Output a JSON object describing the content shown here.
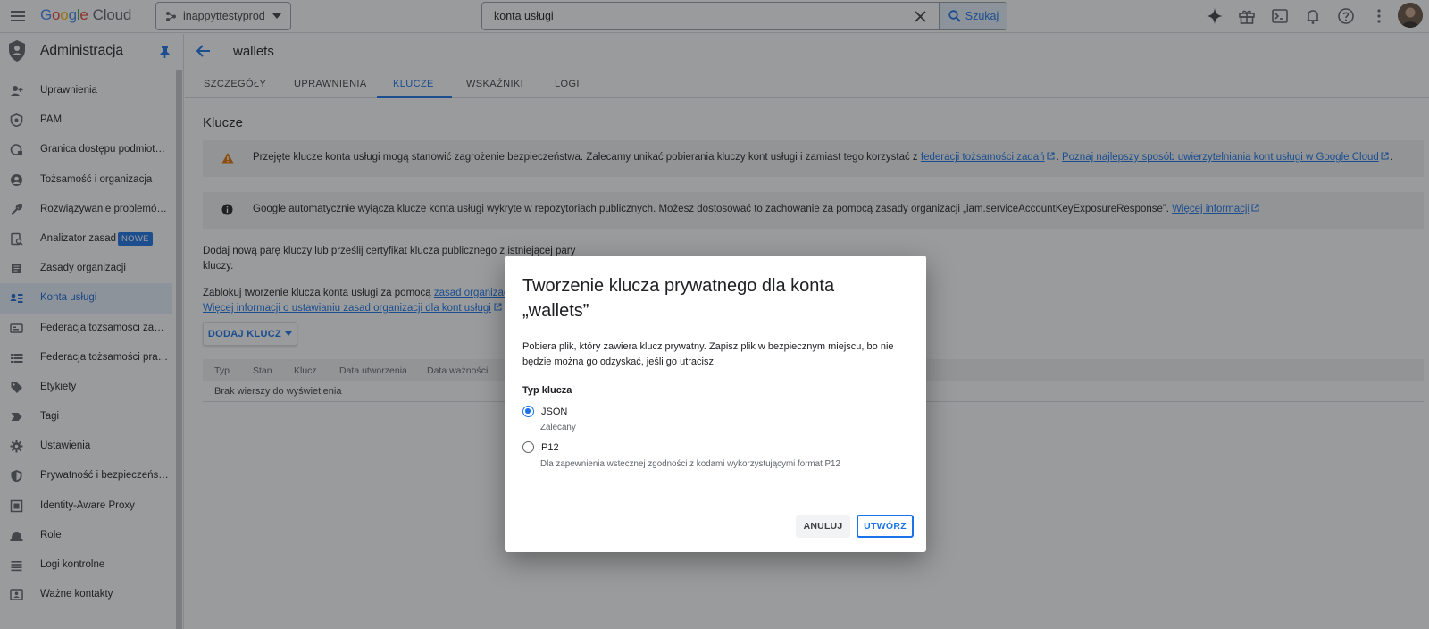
{
  "topbar": {
    "logo_google": "Google",
    "logo_cloud": "Cloud",
    "project": "inappyttestyprod",
    "search_value": "konta usługi",
    "search_button": "Szukaj"
  },
  "sidebar": {
    "title": "Administracja",
    "items": [
      {
        "label": "Uprawnienia",
        "icon": "person-add-icon"
      },
      {
        "label": "PAM",
        "icon": "shield-icon"
      },
      {
        "label": "Granica dostępu podmiot…",
        "icon": "access-boundary-icon"
      },
      {
        "label": "Tożsamość i organizacja",
        "icon": "account-circle-icon"
      },
      {
        "label": "Rozwiązywanie problemó…",
        "icon": "wrench-icon"
      },
      {
        "label": "Analizator zasad",
        "icon": "policy-analyzer-icon",
        "badge": "NOWE"
      },
      {
        "label": "Zasady organizacji",
        "icon": "document-icon"
      },
      {
        "label": "Konta usługi",
        "icon": "service-account-icon"
      },
      {
        "label": "Federacja tożsamości za…",
        "icon": "id-card-icon"
      },
      {
        "label": "Federacja tożsamości pra…",
        "icon": "list-icon"
      },
      {
        "label": "Etykiety",
        "icon": "tag-icon"
      },
      {
        "label": "Tagi",
        "icon": "label-arrow-icon"
      },
      {
        "label": "Ustawienia",
        "icon": "gear-icon"
      },
      {
        "label": "Prywatność i bezpieczeńs…",
        "icon": "privacy-shield-icon"
      },
      {
        "label": "Identity-Aware Proxy",
        "icon": "proxy-icon"
      },
      {
        "label": "Role",
        "icon": "role-hat-icon"
      },
      {
        "label": "Logi kontrolne",
        "icon": "lines-icon"
      },
      {
        "label": "Ważne kontakty",
        "icon": "contacts-icon"
      }
    ],
    "active_index": 7
  },
  "page": {
    "title": "wallets",
    "tabs": [
      "SZCZEGÓŁY",
      "UPRAWNIENIA",
      "KLUCZE",
      "WSKAŹNIKI",
      "LOGI"
    ],
    "active_tab": "KLUCZE",
    "section_title": "Klucze",
    "warning": {
      "text": "Przejęte klucze konta usługi mogą stanowić zagrożenie bezpieczeństwa. Zalecamy unikać pobierania kluczy kont usługi i zamiast tego korzystać z ",
      "link1": "federacji tożsamości zadań",
      "sep": ". ",
      "link2": "Poznaj najlepszy sposób uwierzytelniania kont usługi w Google Cloud",
      "end": "."
    },
    "info": {
      "text": "Google automatycznie wyłącza klucze konta usługi wykryte w repozytoriach publicznych. Możesz dostosować to zachowanie za pomocą zasady organizacji „iam.serviceAccountKeyExposureResponse”. ",
      "link": "Więcej informacji"
    },
    "desc1_line1": "Dodaj nową parę kluczy lub prześlij certyfikat klucza publicznego z istniejącej pary",
    "desc1_line2": "kluczy.",
    "desc2_text": "Zablokuj tworzenie klucza konta usługi za pomocą ",
    "desc2_link": "zasad organizacji",
    "desc3_link": "Więcej informacji o ustawianiu zasad organizacji dla kont usługi",
    "add_key": "DODAJ KLUCZ",
    "table_columns": [
      "Typ",
      "Stan",
      "Klucz",
      "Data utworzenia",
      "Data ważności"
    ],
    "table_empty": "Brak wierszy do wyświetlenia"
  },
  "dialog": {
    "title": "Tworzenie klucza prywatnego dla konta „wallets”",
    "text": "Pobiera plik, który zawiera klucz prywatny. Zapisz plik w bezpiecznym miejscu, bo nie będzie można go odzyskać, jeśli go utracisz.",
    "key_type_label": "Typ klucza",
    "options": [
      {
        "label": "JSON",
        "sub": "Zalecany",
        "selected": true
      },
      {
        "label": "P12",
        "sub": "Dla zapewnienia wstecznej zgodności z kodami wykorzystującymi format P12",
        "selected": false
      }
    ],
    "cancel": "ANULUJ",
    "create": "UTWÓRZ"
  },
  "colors": {
    "accent": "#1a73e8",
    "warning": "#e37400"
  }
}
